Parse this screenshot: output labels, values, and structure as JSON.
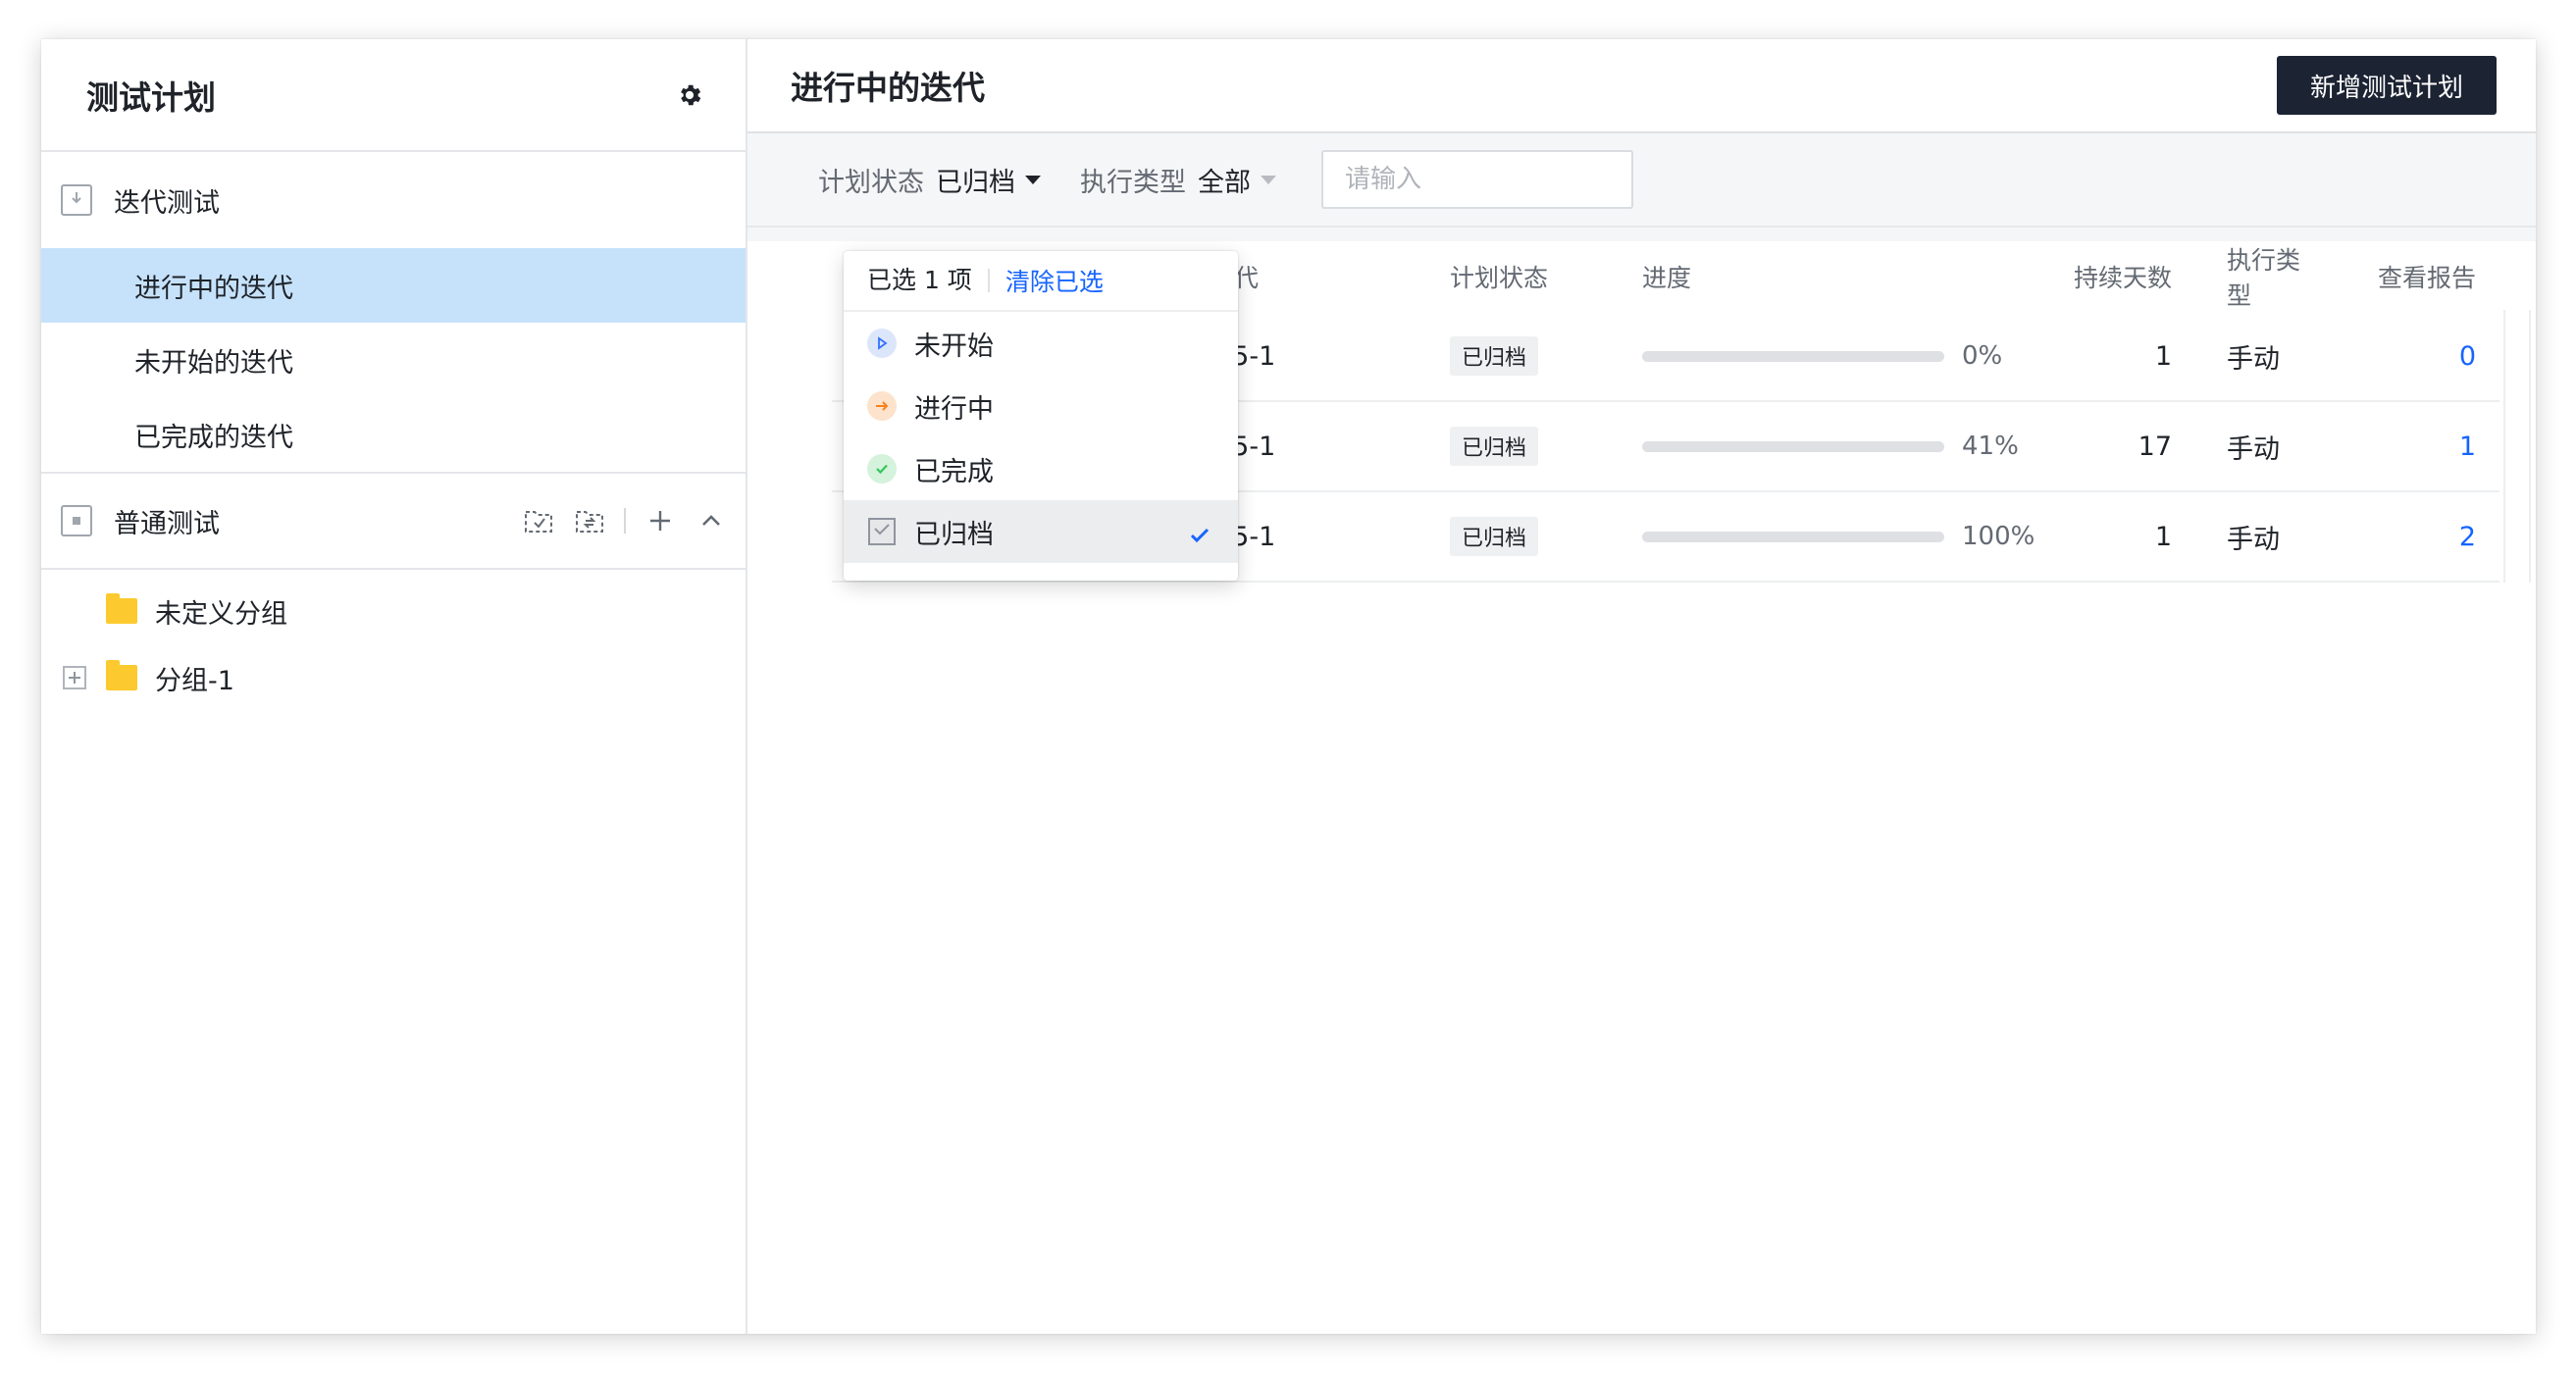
{
  "sidebar": {
    "title": "测试计划",
    "iteration_section": {
      "label": "迭代测试",
      "items": [
        {
          "label": "进行中的迭代",
          "active": true
        },
        {
          "label": "未开始的迭代",
          "active": false
        },
        {
          "label": "已完成的迭代",
          "active": false
        }
      ]
    },
    "normal_section": {
      "label": "普通测试",
      "folders": [
        {
          "label": "未定义分组"
        },
        {
          "label": "分组-1"
        }
      ]
    }
  },
  "main": {
    "title": "进行中的迭代",
    "add_button": "新增测试计划",
    "filters": {
      "plan_status_label": "计划状态",
      "plan_status_value": "已归档",
      "exec_type_label": "执行类型",
      "exec_type_value": "全部",
      "search_placeholder": "请输入"
    },
    "table": {
      "headers": {
        "iteration": "所属迭代",
        "status": "计划状态",
        "progress": "进度",
        "days": "持续天数",
        "type": "执行类型",
        "report": "查看报告"
      },
      "rows": [
        {
          "iteration": "print-5-1",
          "status": "已归档",
          "progress": 0,
          "progress_text": "0%",
          "days": "1",
          "type": "手动",
          "report": "0"
        },
        {
          "iteration": "print-5-1",
          "status": "已归档",
          "progress": 41,
          "progress_text": "41%",
          "days": "17",
          "type": "手动",
          "report": "1"
        },
        {
          "iteration": "print-5-1",
          "status": "已归档",
          "progress": 100,
          "progress_text": "100%",
          "days": "1",
          "type": "手动",
          "report": "2"
        }
      ]
    }
  },
  "dropdown": {
    "selected_count": "已选 1 项",
    "clear_label": "清除已选",
    "options": [
      {
        "label": "未开始",
        "icon": "play-icon",
        "color": "#3370ff",
        "bg": "#dce6fb",
        "selected": false
      },
      {
        "label": "进行中",
        "icon": "arrow-right-icon",
        "color": "#f5821f",
        "bg": "#fde3cc",
        "selected": false
      },
      {
        "label": "已完成",
        "icon": "check-circle-icon",
        "color": "#34c759",
        "bg": "#d4f2dc",
        "selected": false
      },
      {
        "label": "已归档",
        "icon": "archive-icon",
        "color": "#8f959e",
        "bg": "#e6e7e9",
        "selected": true
      }
    ],
    "accent": "#1664ff"
  }
}
